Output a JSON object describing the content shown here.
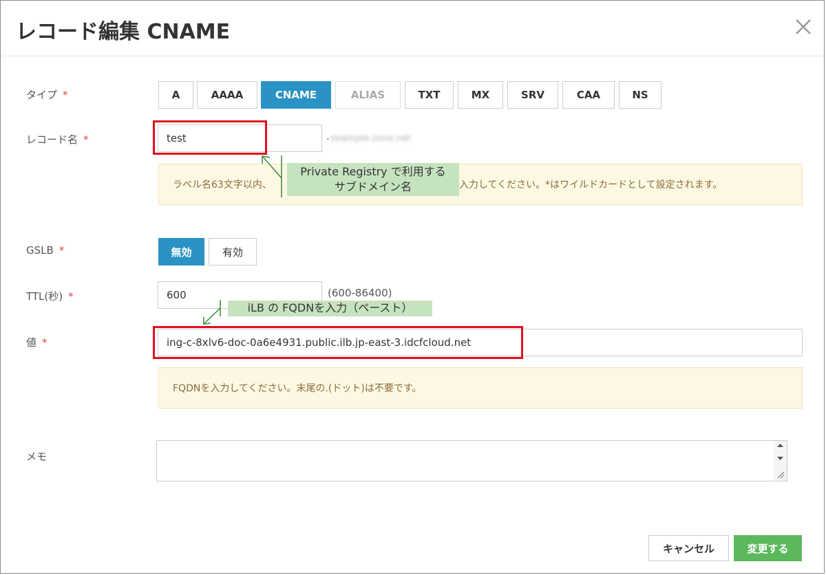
{
  "dialog": {
    "title": "レコード編集 CNAME",
    "close_icon": "close-icon"
  },
  "type_field": {
    "label": "タイプ",
    "required": "*",
    "options": [
      {
        "label": "A",
        "state": "normal"
      },
      {
        "label": "AAAA",
        "state": "normal"
      },
      {
        "label": "CNAME",
        "state": "selected"
      },
      {
        "label": "ALIAS",
        "state": "disabled"
      },
      {
        "label": "TXT",
        "state": "normal"
      },
      {
        "label": "MX",
        "state": "normal"
      },
      {
        "label": "SRV",
        "state": "normal"
      },
      {
        "label": "CAA",
        "state": "normal"
      },
      {
        "label": "NS",
        "state": "normal"
      }
    ]
  },
  "record_name": {
    "label": "レコード名",
    "required": "*",
    "value": "test",
    "domain_suffix_dot": ".",
    "domain_suffix_blurred": "example-zone.net",
    "hint_left": "ラベル名63文字以内、",
    "hint_right": "入力してください。*はワイルドカードとして設定されます。"
  },
  "callout_subdomain": {
    "line1": "Private Registry で利用する",
    "line2": "サブドメイン名"
  },
  "gslb": {
    "label": "GSLB",
    "required": "*",
    "options": [
      {
        "label": "無効",
        "state": "selected"
      },
      {
        "label": "有効",
        "state": "normal"
      }
    ]
  },
  "ttl": {
    "label": "TTL(秒)",
    "required": "*",
    "value": "600",
    "range": "(600-86400)"
  },
  "callout_fqdn": {
    "text": "iLB の FQDNを入力（ペースト）"
  },
  "value_field": {
    "label": "値",
    "required": "*",
    "value": "ing-c-8xlv6-doc-0a6e4931.public.ilb.jp-east-3.idcfcloud.net",
    "hint": "FQDNを入力してください。末尾の.(ドット)は不要です。"
  },
  "memo": {
    "label": "メモ",
    "value": ""
  },
  "footer": {
    "cancel_label": "キャンセル",
    "submit_label": "変更する"
  },
  "colors": {
    "primary": "#2a92c4",
    "submit": "#5cb85c",
    "required": "#e0463a",
    "highlight_border": "#e0101e",
    "callout_bg": "#c5e3bf",
    "hint_bg": "#fcf8e3"
  }
}
